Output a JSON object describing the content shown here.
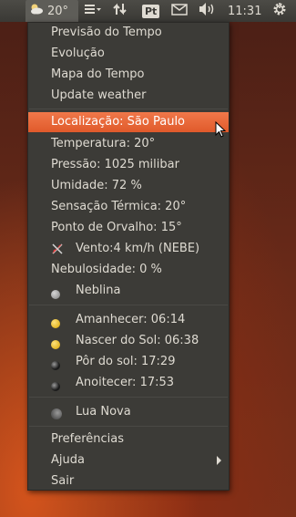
{
  "panel": {
    "temperature": "20°",
    "keyboard_layout": "Pt",
    "clock": "11:31",
    "icons": [
      "weather-cloud-icon",
      "menu-icon",
      "network-icon",
      "mail-icon",
      "volume-icon",
      "gear-icon"
    ]
  },
  "menu": {
    "items": [
      {
        "label": "Previsão do Tempo"
      },
      {
        "label": "Evolução"
      },
      {
        "label": "Mapa do Tempo"
      },
      {
        "label": "Update weather"
      }
    ],
    "location": "Localização: São Paulo",
    "conditions": [
      {
        "label": "Temperatura: 20°"
      },
      {
        "label": "Pressão: 1025 milibar"
      },
      {
        "label": "Umidade: 72 %"
      },
      {
        "label": "Sensação Térmica: 20°"
      },
      {
        "label": "Ponto de Orvalho: 15°"
      },
      {
        "label": "Vento:4 km/h (NEBE)"
      },
      {
        "label": "Nebulosidade: 0 %"
      },
      {
        "label": "Neblina"
      }
    ],
    "sun": [
      {
        "label": "Amanhecer: 06:14"
      },
      {
        "label": "Nascer do Sol: 06:38"
      },
      {
        "label": "Pôr do sol: 17:29"
      },
      {
        "label": "Anoitecer: 17:53"
      }
    ],
    "moon": "Lua Nova",
    "footer": [
      {
        "label": "Preferências"
      },
      {
        "label": "Ajuda"
      },
      {
        "label": "Sair"
      }
    ]
  },
  "colors": {
    "highlight": "#e8673a",
    "menu_bg": "#3c3b37",
    "text": "#dfdbd2"
  }
}
